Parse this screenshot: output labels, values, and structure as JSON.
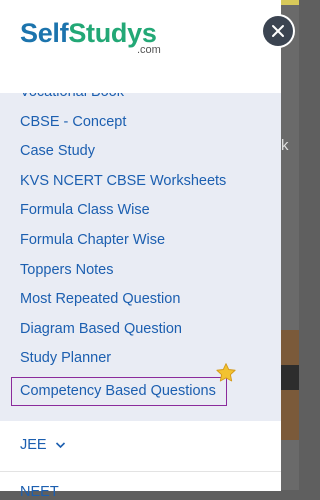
{
  "logo": {
    "brand_a": "Self",
    "brand_b": "Studys",
    "suffix": ".com"
  },
  "menu": {
    "items": [
      "Vocational Book",
      "CBSE - Concept",
      "Case Study",
      "KVS NCERT CBSE Worksheets",
      "Formula Class Wise",
      "Formula Chapter Wise",
      "Toppers Notes",
      "Most Repeated Question",
      "Diagram Based Question",
      "Study Planner",
      "Competency Based Questions"
    ],
    "active_index": 10
  },
  "sections": {
    "jee": "JEE",
    "neet": "NEET"
  },
  "backdrop": {
    "partial_letter": "k"
  },
  "colors": {
    "link": "#1c5fb0",
    "logo_self": "#1c74ad",
    "logo_studys": "#23a876",
    "active_outline": "#8b2b9c",
    "drawer_bg": "#e9ecf4",
    "close_bg": "#3b4451"
  },
  "icons": {
    "close": "close-icon",
    "star": "star-icon",
    "chevron": "chevron-down-icon"
  }
}
